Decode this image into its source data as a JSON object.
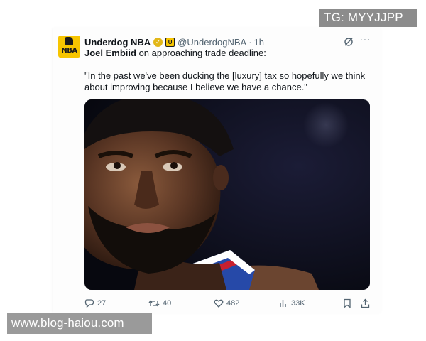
{
  "watermarks": {
    "top": "TG: MYYJJPP",
    "bottom": "www.blog-haiou.com"
  },
  "tweet": {
    "avatar_text": "NBA",
    "display_name": "Underdog NBA",
    "handle": "@UnderdogNBA",
    "separator": "·",
    "time": "1h",
    "verified_icon": "verified-badge-icon",
    "affiliate_icon": "affiliate-badge-icon",
    "body_lead_bold": "Joel Embiid",
    "body_lead_rest": " on approaching trade deadline:",
    "quote": "\"In the past we've been ducking the [luxury] tax so hopefully we think about improving because I believe we have a chance.\"",
    "media_subject": "player-photo",
    "metrics": {
      "replies": "27",
      "reposts": "40",
      "likes": "482",
      "views": "33K"
    },
    "colors": {
      "text": "#0f1419",
      "muted": "#536471",
      "badge_gold": "#e2b719",
      "avatar_yellow": "#f7c500"
    }
  }
}
